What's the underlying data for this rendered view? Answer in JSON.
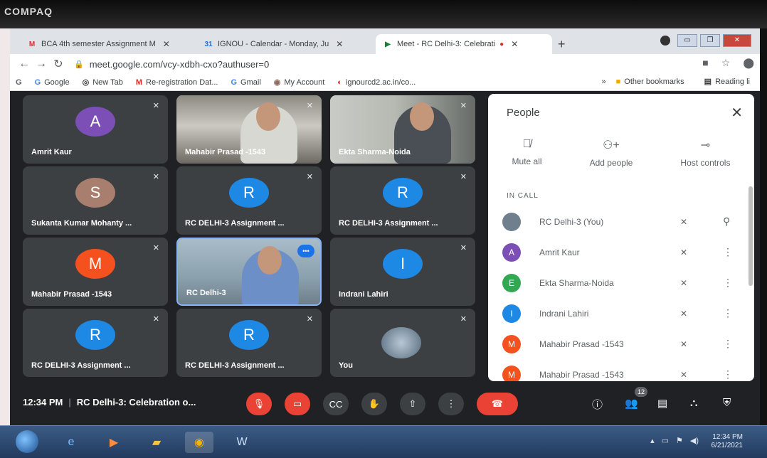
{
  "monitor": {
    "brand": "COMPAQ"
  },
  "browser": {
    "tabs": [
      {
        "icon": "gmail-icon",
        "favicon_text": "M",
        "label": "BCA 4th semester Assignment M",
        "color": "#d93025"
      },
      {
        "icon": "calendar-icon",
        "favicon_text": "31",
        "label": "IGNOU - Calendar - Monday, Ju",
        "color": "#1a73e8"
      },
      {
        "icon": "meet-icon",
        "favicon_text": "▶",
        "label": "Meet - RC Delhi-3: Celebrati",
        "color": "#188038"
      }
    ],
    "url": "meet.google.com/vcy-xdbh-cxo?authuser=0",
    "bookmarks": [
      {
        "icon_text": "G",
        "label": "Google",
        "color": "#4285f4"
      },
      {
        "icon_text": "◎",
        "label": "New Tab",
        "color": "#5f6368"
      },
      {
        "icon_text": "M",
        "label": "Re-registration Dat...",
        "color": "#d93025"
      },
      {
        "icon_text": "G",
        "label": "Gmail",
        "color": "#4285f4"
      },
      {
        "icon_text": "◉",
        "label": "My Account",
        "color": "#8d6e63"
      },
      {
        "icon_text": "◐",
        "label": "ignourcd2.ac.in/co...",
        "color": "#c5221f"
      }
    ],
    "bookmarks_more": "»",
    "other_bookmarks": "Other bookmarks",
    "reading_list": "Reading li"
  },
  "tiles": [
    {
      "name": "Amrit Kaur",
      "initial": "A",
      "color": "#7b4fb5"
    },
    {
      "name": "Mahabir Prasad -1543",
      "video": true
    },
    {
      "name": "Ekta Sharma-Noida",
      "video": true
    },
    {
      "name": "Sukanta Kumar Mohanty ...",
      "initial": "S",
      "color": "#a87f6e"
    },
    {
      "name": "RC DELHI-3 Assignment ...",
      "initial": "R",
      "color": "#1e88e5"
    },
    {
      "name": "RC DELHI-3 Assignment ...",
      "initial": "R",
      "color": "#1e88e5"
    },
    {
      "name": "Mahabir Prasad -1543",
      "initial": "M",
      "color": "#f4511e"
    },
    {
      "name": "RC Delhi-3",
      "video": true,
      "speaking": true
    },
    {
      "name": "Indrani Lahiri",
      "initial": "I",
      "color": "#1e88e5"
    },
    {
      "name": "RC DELHI-3 Assignment ...",
      "initial": "R",
      "color": "#1e88e5"
    },
    {
      "name": "RC DELHI-3 Assignment ...",
      "initial": "R",
      "color": "#1e88e5"
    },
    {
      "name": "You",
      "self": true
    }
  ],
  "people_panel": {
    "title": "People",
    "actions": [
      {
        "label": "Mute all",
        "icon": "mic-off-icon"
      },
      {
        "label": "Add people",
        "icon": "add-person-icon"
      },
      {
        "label": "Host controls",
        "icon": "toggle-icon"
      }
    ],
    "section": "IN CALL",
    "participants": [
      {
        "name": "RC Delhi-3 (You)",
        "initial": "",
        "color": "#6f7f8d",
        "trailing": "pin-icon"
      },
      {
        "name": "Amrit Kaur",
        "initial": "A",
        "color": "#7b4fb5",
        "trailing": "more-icon"
      },
      {
        "name": "Ekta Sharma-Noida",
        "initial": "E",
        "color": "#33a852",
        "trailing": "more-icon"
      },
      {
        "name": "Indrani Lahiri",
        "initial": "I",
        "color": "#1e88e5",
        "trailing": "more-icon"
      },
      {
        "name": "Mahabir Prasad -1543",
        "initial": "M",
        "color": "#f4511e",
        "trailing": "more-icon"
      },
      {
        "name": "Mahabir Prasad -1543",
        "initial": "M",
        "color": "#f4511e",
        "trailing": "more-icon"
      }
    ]
  },
  "bottom_bar": {
    "time": "12:34 PM",
    "meeting_title": "RC Delhi-3: Celebration o...",
    "participant_count": "12"
  },
  "taskbar": {
    "clock_time": "12:34 PM",
    "clock_date": "6/21/2021"
  }
}
